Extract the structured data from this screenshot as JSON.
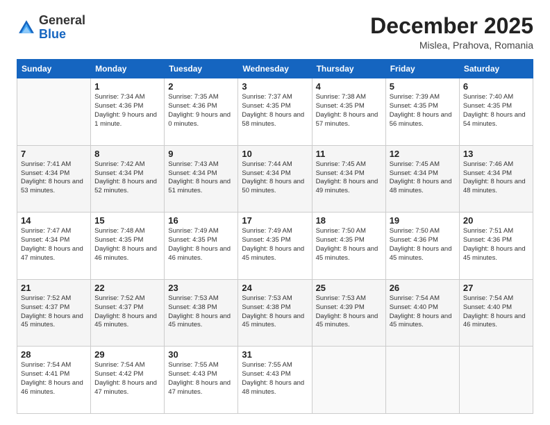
{
  "header": {
    "logo_general": "General",
    "logo_blue": "Blue",
    "month_title": "December 2025",
    "subtitle": "Mislea, Prahova, Romania"
  },
  "weekdays": [
    "Sunday",
    "Monday",
    "Tuesday",
    "Wednesday",
    "Thursday",
    "Friday",
    "Saturday"
  ],
  "weeks": [
    [
      {
        "day": null,
        "text": ""
      },
      {
        "day": "1",
        "sunrise": "Sunrise: 7:34 AM",
        "sunset": "Sunset: 4:36 PM",
        "daylight": "Daylight: 9 hours and 1 minute."
      },
      {
        "day": "2",
        "sunrise": "Sunrise: 7:35 AM",
        "sunset": "Sunset: 4:36 PM",
        "daylight": "Daylight: 9 hours and 0 minutes."
      },
      {
        "day": "3",
        "sunrise": "Sunrise: 7:37 AM",
        "sunset": "Sunset: 4:35 PM",
        "daylight": "Daylight: 8 hours and 58 minutes."
      },
      {
        "day": "4",
        "sunrise": "Sunrise: 7:38 AM",
        "sunset": "Sunset: 4:35 PM",
        "daylight": "Daylight: 8 hours and 57 minutes."
      },
      {
        "day": "5",
        "sunrise": "Sunrise: 7:39 AM",
        "sunset": "Sunset: 4:35 PM",
        "daylight": "Daylight: 8 hours and 56 minutes."
      },
      {
        "day": "6",
        "sunrise": "Sunrise: 7:40 AM",
        "sunset": "Sunset: 4:35 PM",
        "daylight": "Daylight: 8 hours and 54 minutes."
      }
    ],
    [
      {
        "day": "7",
        "sunrise": "Sunrise: 7:41 AM",
        "sunset": "Sunset: 4:34 PM",
        "daylight": "Daylight: 8 hours and 53 minutes."
      },
      {
        "day": "8",
        "sunrise": "Sunrise: 7:42 AM",
        "sunset": "Sunset: 4:34 PM",
        "daylight": "Daylight: 8 hours and 52 minutes."
      },
      {
        "day": "9",
        "sunrise": "Sunrise: 7:43 AM",
        "sunset": "Sunset: 4:34 PM",
        "daylight": "Daylight: 8 hours and 51 minutes."
      },
      {
        "day": "10",
        "sunrise": "Sunrise: 7:44 AM",
        "sunset": "Sunset: 4:34 PM",
        "daylight": "Daylight: 8 hours and 50 minutes."
      },
      {
        "day": "11",
        "sunrise": "Sunrise: 7:45 AM",
        "sunset": "Sunset: 4:34 PM",
        "daylight": "Daylight: 8 hours and 49 minutes."
      },
      {
        "day": "12",
        "sunrise": "Sunrise: 7:45 AM",
        "sunset": "Sunset: 4:34 PM",
        "daylight": "Daylight: 8 hours and 48 minutes."
      },
      {
        "day": "13",
        "sunrise": "Sunrise: 7:46 AM",
        "sunset": "Sunset: 4:34 PM",
        "daylight": "Daylight: 8 hours and 48 minutes."
      }
    ],
    [
      {
        "day": "14",
        "sunrise": "Sunrise: 7:47 AM",
        "sunset": "Sunset: 4:34 PM",
        "daylight": "Daylight: 8 hours and 47 minutes."
      },
      {
        "day": "15",
        "sunrise": "Sunrise: 7:48 AM",
        "sunset": "Sunset: 4:35 PM",
        "daylight": "Daylight: 8 hours and 46 minutes."
      },
      {
        "day": "16",
        "sunrise": "Sunrise: 7:49 AM",
        "sunset": "Sunset: 4:35 PM",
        "daylight": "Daylight: 8 hours and 46 minutes."
      },
      {
        "day": "17",
        "sunrise": "Sunrise: 7:49 AM",
        "sunset": "Sunset: 4:35 PM",
        "daylight": "Daylight: 8 hours and 45 minutes."
      },
      {
        "day": "18",
        "sunrise": "Sunrise: 7:50 AM",
        "sunset": "Sunset: 4:35 PM",
        "daylight": "Daylight: 8 hours and 45 minutes."
      },
      {
        "day": "19",
        "sunrise": "Sunrise: 7:50 AM",
        "sunset": "Sunset: 4:36 PM",
        "daylight": "Daylight: 8 hours and 45 minutes."
      },
      {
        "day": "20",
        "sunrise": "Sunrise: 7:51 AM",
        "sunset": "Sunset: 4:36 PM",
        "daylight": "Daylight: 8 hours and 45 minutes."
      }
    ],
    [
      {
        "day": "21",
        "sunrise": "Sunrise: 7:52 AM",
        "sunset": "Sunset: 4:37 PM",
        "daylight": "Daylight: 8 hours and 45 minutes."
      },
      {
        "day": "22",
        "sunrise": "Sunrise: 7:52 AM",
        "sunset": "Sunset: 4:37 PM",
        "daylight": "Daylight: 8 hours and 45 minutes."
      },
      {
        "day": "23",
        "sunrise": "Sunrise: 7:53 AM",
        "sunset": "Sunset: 4:38 PM",
        "daylight": "Daylight: 8 hours and 45 minutes."
      },
      {
        "day": "24",
        "sunrise": "Sunrise: 7:53 AM",
        "sunset": "Sunset: 4:38 PM",
        "daylight": "Daylight: 8 hours and 45 minutes."
      },
      {
        "day": "25",
        "sunrise": "Sunrise: 7:53 AM",
        "sunset": "Sunset: 4:39 PM",
        "daylight": "Daylight: 8 hours and 45 minutes."
      },
      {
        "day": "26",
        "sunrise": "Sunrise: 7:54 AM",
        "sunset": "Sunset: 4:40 PM",
        "daylight": "Daylight: 8 hours and 45 minutes."
      },
      {
        "day": "27",
        "sunrise": "Sunrise: 7:54 AM",
        "sunset": "Sunset: 4:40 PM",
        "daylight": "Daylight: 8 hours and 46 minutes."
      }
    ],
    [
      {
        "day": "28",
        "sunrise": "Sunrise: 7:54 AM",
        "sunset": "Sunset: 4:41 PM",
        "daylight": "Daylight: 8 hours and 46 minutes."
      },
      {
        "day": "29",
        "sunrise": "Sunrise: 7:54 AM",
        "sunset": "Sunset: 4:42 PM",
        "daylight": "Daylight: 8 hours and 47 minutes."
      },
      {
        "day": "30",
        "sunrise": "Sunrise: 7:55 AM",
        "sunset": "Sunset: 4:43 PM",
        "daylight": "Daylight: 8 hours and 47 minutes."
      },
      {
        "day": "31",
        "sunrise": "Sunrise: 7:55 AM",
        "sunset": "Sunset: 4:43 PM",
        "daylight": "Daylight: 8 hours and 48 minutes."
      },
      {
        "day": null,
        "text": ""
      },
      {
        "day": null,
        "text": ""
      },
      {
        "day": null,
        "text": ""
      }
    ]
  ]
}
